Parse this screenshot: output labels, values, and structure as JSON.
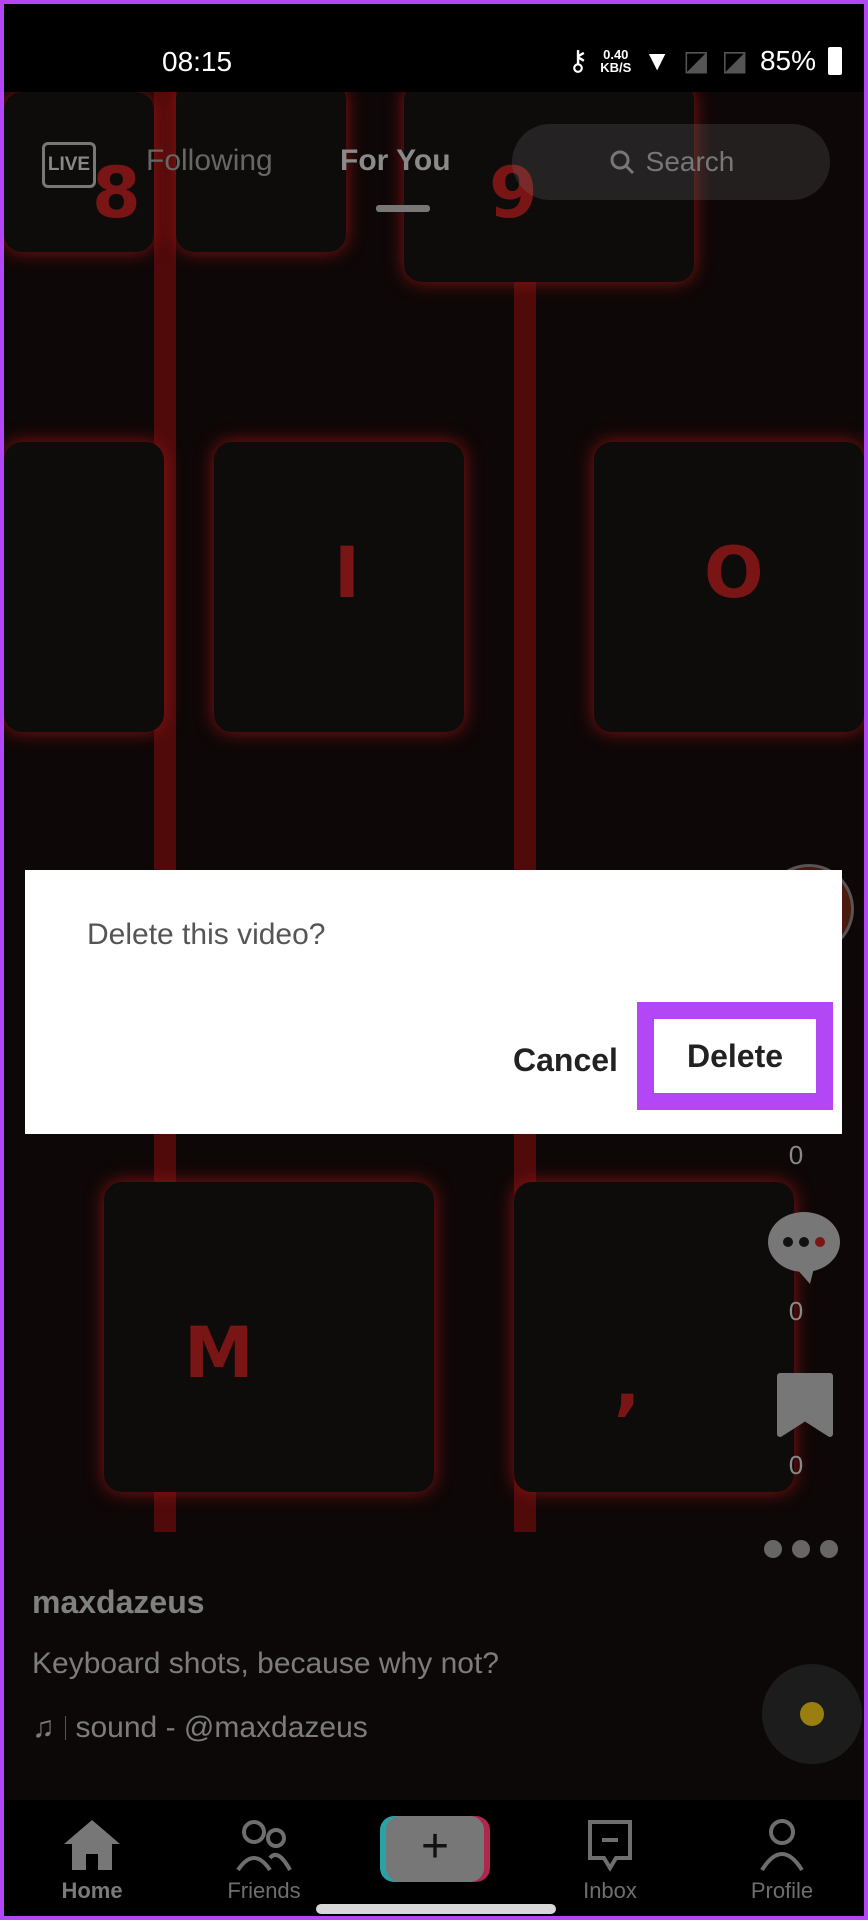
{
  "status_bar": {
    "time": "08:15",
    "net_speed_value": "0.40",
    "net_speed_unit": "KB/S",
    "battery": "85%"
  },
  "top_bar": {
    "live_label": "LIVE",
    "tabs": [
      {
        "label": "Following",
        "active": false
      },
      {
        "label": "For You",
        "active": true
      }
    ],
    "search_label": "Search"
  },
  "video_bg_keys": [
    "8",
    "9",
    "I",
    "O",
    "M",
    ","
  ],
  "side_actions": {
    "like_count": "0",
    "comment_count": "0",
    "bookmark_count": "0"
  },
  "caption": {
    "username": "maxdazeus",
    "description": "Keyboard shots, because why not?",
    "sound": "sound - @maxdazeus"
  },
  "nav": {
    "items": [
      {
        "label": "Home",
        "active": true
      },
      {
        "label": "Friends"
      },
      {
        "label": "Inbox"
      },
      {
        "label": "Profile"
      }
    ]
  },
  "dialog": {
    "title": "Delete this video?",
    "cancel_label": "Cancel",
    "delete_label": "Delete"
  },
  "colors": {
    "highlight": "#b347f5",
    "keyboard_glow": "#8a1414"
  }
}
